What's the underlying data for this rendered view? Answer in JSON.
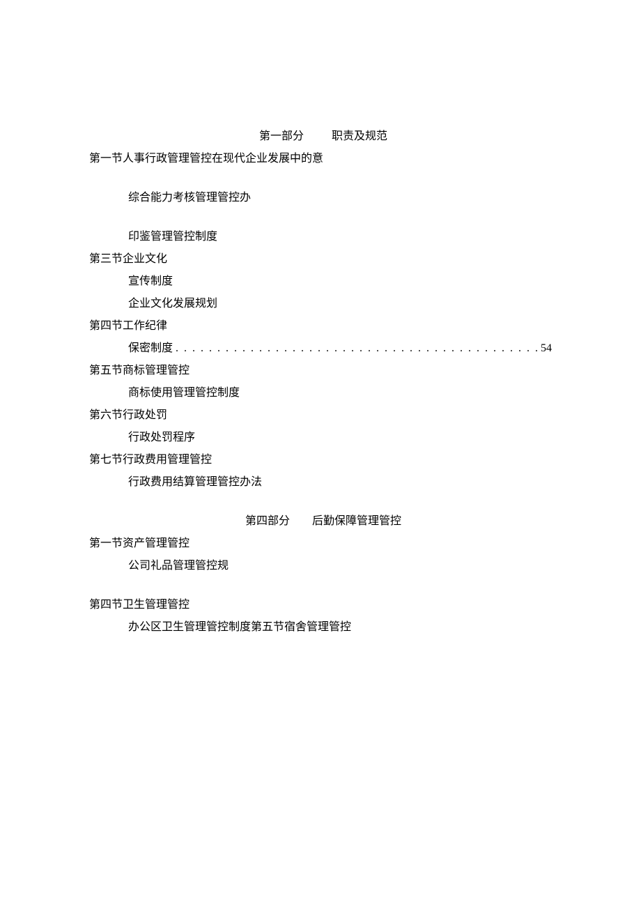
{
  "part1": {
    "header_left": "第一部分",
    "header_right": "职责及规范",
    "section1": "第一节人事行政管理管控在现代企业发展中的意",
    "item_assessment": "综合能力考核管理管控办",
    "item_seal": "印鉴管理管控制度",
    "section3": "第三节企业文化",
    "item_publicity": "宣传制度",
    "item_culture_plan": "企业文化发展规划",
    "section4": "第四节工作纪律",
    "item_confidential": "保密制度",
    "item_confidential_page": "54",
    "section5": "第五节商标管理管控",
    "item_trademark": "商标使用管理管控制度",
    "section6": "第六节行政处罚",
    "item_penalty": "行政处罚程序",
    "section7": "第七节行政费用管理管控",
    "item_expense": "行政费用结算管理管控办法"
  },
  "part4": {
    "header_left": "第四部分",
    "header_right": "后勤保障管理管控",
    "section1": "第一节资产管理管控",
    "item_gift": "公司礼品管理管控规",
    "section4": "第四节卫生管理管控",
    "item_hygiene": "办公区卫生管理管控制度第五节宿舍管理管控"
  }
}
